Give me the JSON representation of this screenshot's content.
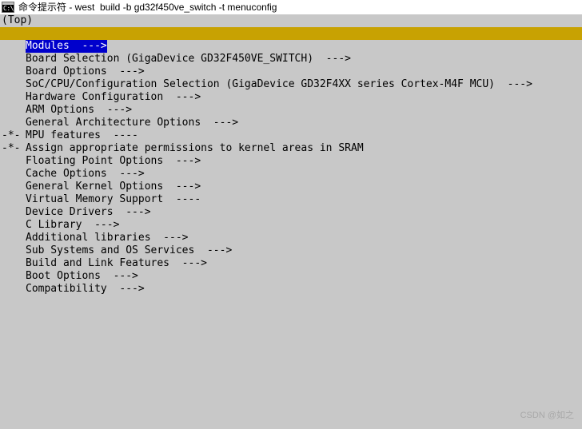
{
  "window": {
    "icon": "command-prompt-icon",
    "icon_glyph": "C:\\",
    "title": "命令提示符 - west  build -b gd32f450ve_switch -t menuconfig"
  },
  "colors": {
    "titlebar_bg": "#ffffff",
    "terminal_bg": "#c8c8c8",
    "terminal_fg": "#000000",
    "separator_gold": "#c8a202",
    "selection_bg": "#0000cc",
    "selection_fg": "#ffffff",
    "watermark_fg": "#a8a8a8"
  },
  "menuconfig": {
    "breadcrumb": "(Top)",
    "separator": "",
    "items": [
      {
        "prefix": "",
        "label": "Modules  --->",
        "selected": true
      },
      {
        "prefix": "",
        "label": "Board Selection (GigaDevice GD32F450VE_SWITCH)  --->",
        "selected": false
      },
      {
        "prefix": "",
        "label": "Board Options  --->",
        "selected": false
      },
      {
        "prefix": "",
        "label": "SoC/CPU/Configuration Selection (GigaDevice GD32F4XX series Cortex-M4F MCU)  --->",
        "selected": false
      },
      {
        "prefix": "",
        "label": "Hardware Configuration  --->",
        "selected": false
      },
      {
        "prefix": "",
        "label": "ARM Options  --->",
        "selected": false
      },
      {
        "prefix": "",
        "label": "General Architecture Options  --->",
        "selected": false
      },
      {
        "prefix": "-*-",
        "label": "MPU features  ----",
        "selected": false
      },
      {
        "prefix": "-*-",
        "label": "Assign appropriate permissions to kernel areas in SRAM",
        "selected": false
      },
      {
        "prefix": "",
        "label": "Floating Point Options  --->",
        "selected": false
      },
      {
        "prefix": "",
        "label": "Cache Options  --->",
        "selected": false
      },
      {
        "prefix": "",
        "label": "General Kernel Options  --->",
        "selected": false
      },
      {
        "prefix": "",
        "label": "Virtual Memory Support  ----",
        "selected": false
      },
      {
        "prefix": "",
        "label": "Device Drivers  --->",
        "selected": false
      },
      {
        "prefix": "",
        "label": "C Library  --->",
        "selected": false
      },
      {
        "prefix": "",
        "label": "Additional libraries  --->",
        "selected": false
      },
      {
        "prefix": "",
        "label": "Sub Systems and OS Services  --->",
        "selected": false
      },
      {
        "prefix": "",
        "label": "Build and Link Features  --->",
        "selected": false
      },
      {
        "prefix": "",
        "label": "Boot Options  --->",
        "selected": false
      },
      {
        "prefix": "",
        "label": "Compatibility  --->",
        "selected": false
      }
    ]
  },
  "watermark": {
    "text": "CSDN @如之"
  }
}
